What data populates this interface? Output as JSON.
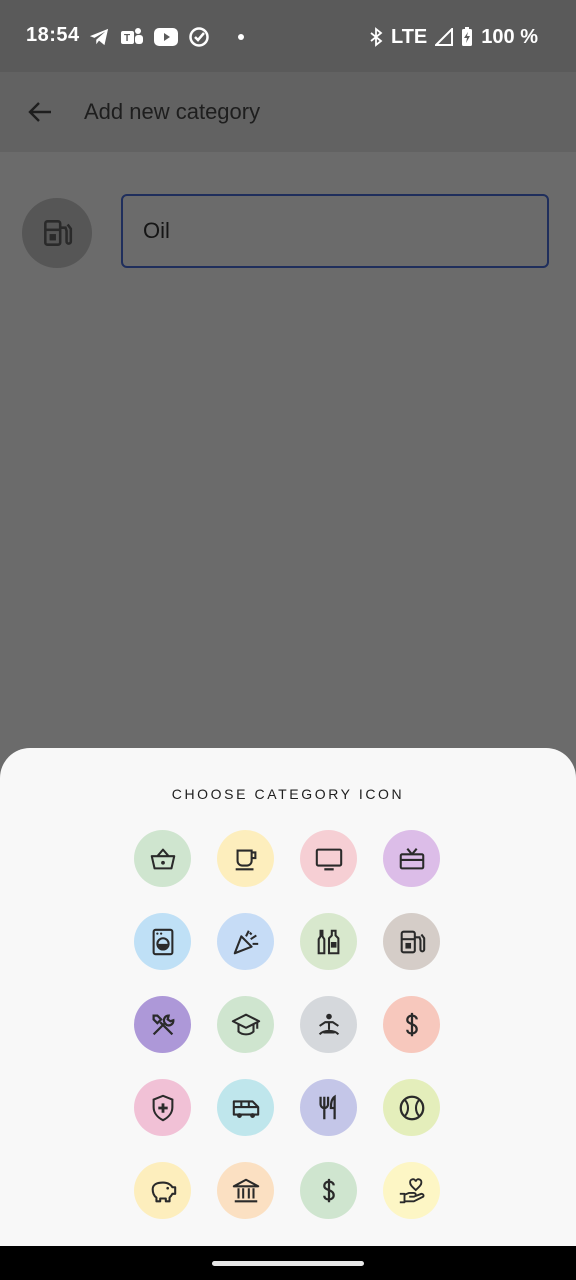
{
  "status_bar": {
    "time": "18:54",
    "network": "LTE",
    "battery": "100 %",
    "left_icons": [
      "telegram-icon",
      "teams-icon",
      "youtube-icon",
      "task-check-icon"
    ],
    "right_icons": [
      "bluetooth-icon",
      "signal-icon",
      "battery-charging-icon"
    ]
  },
  "app_bar": {
    "title": "Add new category",
    "back_icon": "arrow-back-icon"
  },
  "form": {
    "selected_icon": "fuel-pump-icon",
    "name_value": "Oil"
  },
  "sheet": {
    "title": "CHOOSE CATEGORY ICON",
    "icons": [
      {
        "name": "shopping-basket-icon",
        "color": "#cfe5cf"
      },
      {
        "name": "coffee-cup-icon",
        "color": "#fdeebd"
      },
      {
        "name": "tv-icon",
        "color": "#f6cfd4"
      },
      {
        "name": "gift-icon",
        "color": "#dcbde8"
      },
      {
        "name": "washing-machine-icon",
        "color": "#bfe0f6"
      },
      {
        "name": "party-popper-icon",
        "color": "#c6dcf6"
      },
      {
        "name": "bottles-icon",
        "color": "#d8e8cd"
      },
      {
        "name": "fuel-pump-icon",
        "color": "#d5cdc8"
      },
      {
        "name": "tools-icon",
        "color": "#ad98d8"
      },
      {
        "name": "graduation-cap-icon",
        "color": "#cfe5cf"
      },
      {
        "name": "meditation-icon",
        "color": "#d5d8dc"
      },
      {
        "name": "dollar-icon",
        "color": "#f7c8bd"
      },
      {
        "name": "health-shield-icon",
        "color": "#f1c1d6"
      },
      {
        "name": "van-icon",
        "color": "#bfe6ec"
      },
      {
        "name": "restaurant-icon",
        "color": "#c4c6e8"
      },
      {
        "name": "tennis-ball-icon",
        "color": "#e4eebb"
      },
      {
        "name": "piggy-bank-icon",
        "color": "#fdeebd"
      },
      {
        "name": "bank-icon",
        "color": "#fbe0c2"
      },
      {
        "name": "money-icon",
        "color": "#cfe5cf"
      },
      {
        "name": "charity-icon",
        "color": "#fdf6c5"
      }
    ]
  }
}
